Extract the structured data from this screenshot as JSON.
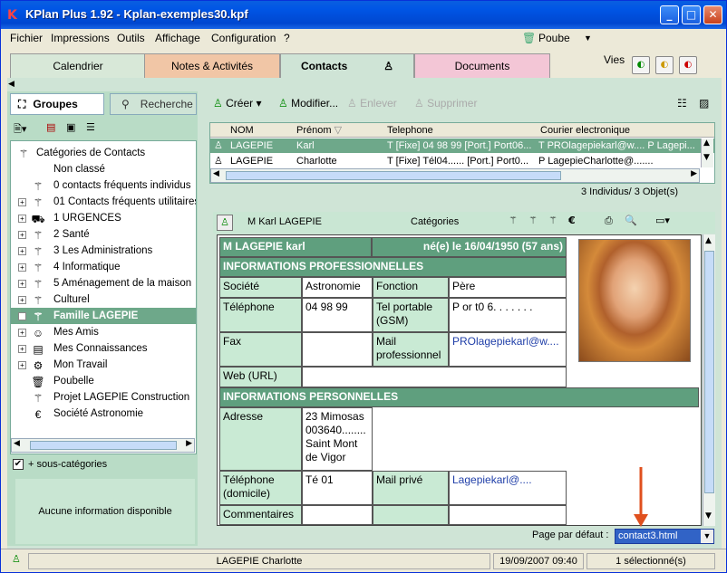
{
  "window": {
    "title": "KPlan Plus 1.92 - Kplan-exemples30.kpf",
    "app_icon": "K"
  },
  "menu": {
    "items": [
      "Fichier",
      "Impressions",
      "Outils",
      "Affichage",
      "Configuration",
      "?"
    ],
    "poube": "Poube"
  },
  "tabs": {
    "items": [
      "Calendrier",
      "Notes & Activités",
      "Contacts",
      "Documents"
    ],
    "active": "Contacts",
    "vies_label": "Vies"
  },
  "left": {
    "tabs": [
      "Groupes",
      "Recherche"
    ],
    "tree": [
      {
        "label": "Catégories de Contacts",
        "icon": "wand-icon"
      },
      {
        "label": "Non classé",
        "icon": ""
      },
      {
        "label": "0 contacts fréquents individus",
        "icon": "wand-icon"
      },
      {
        "label": "01 Contacts  fréquents utilitaires",
        "icon": "wand-icon"
      },
      {
        "label": "1 URGENCES",
        "icon": "truck-icon"
      },
      {
        "label": "2 Santé",
        "icon": "wand-icon"
      },
      {
        "label": "3  Les Administrations",
        "icon": "wand-icon"
      },
      {
        "label": "4 Informatique",
        "icon": "wand-icon"
      },
      {
        "label": "5 Aménagement de la maison",
        "icon": "wand-icon"
      },
      {
        "label": "Culturel",
        "icon": "wand-icon"
      },
      {
        "label": "Famille LAGEPIE",
        "icon": "wand-icon"
      },
      {
        "label": "Mes Amis",
        "icon": "smiley-icon"
      },
      {
        "label": "Mes Connaissances",
        "icon": "cards-icon"
      },
      {
        "label": "Mon Travail",
        "icon": "gear-icon"
      },
      {
        "label": "Poubelle",
        "icon": "trash-icon"
      },
      {
        "label": "Projet LAGEPIE Construction",
        "icon": "wand-icon"
      },
      {
        "label": "Société Astronomie",
        "icon": "euro-icon"
      }
    ],
    "selected_index": 10,
    "subcat_label": "+ sous-catégories",
    "no_info": "Aucune information disponible"
  },
  "toolbar": {
    "create": "Créer",
    "modify": "Modifier...",
    "remove": "Enlever",
    "delete": "Supprimer"
  },
  "grid": {
    "headers": [
      "NOM",
      "Prénom",
      "Telephone",
      "Courier electronique"
    ],
    "rows": [
      [
        "LAGEPIE",
        "Karl",
        "T [Fixe] 04 98 99 [Port.] Port06...",
        "T PROlagepiekarl@w....  P Lagepi..."
      ],
      [
        "LAGEPIE",
        "Charlotte",
        "T [Fixe] Tél04...... [Port.] Port0...",
        "P LagepieCharlotte@......."
      ]
    ],
    "count": "3 Individus/ 3 Objet(s)"
  },
  "card": {
    "header_name": "M Karl LAGEPIE",
    "categories": "Catégories",
    "name": "M LAGEPIE karl",
    "birth": "né(e) le 16/04/1950 (57 ans)",
    "pro_title": "INFORMATIONS PROFESSIONNELLES",
    "societe_label": "Société",
    "societe_value": "Astronomie",
    "fonction_label": "Fonction",
    "fonction_value": "Père",
    "tel_label": "Téléphone",
    "tel_value": "04 98 99",
    "telport_label": "Tel portable (GSM)",
    "telport_value": "P or t0 6. . . . . . .",
    "fax_label": "Fax",
    "mailpro_label": "Mail professionnel",
    "mailpro_value": "PROlagepiekarl@w....",
    "web_label": "Web (URL)",
    "perso_title": "INFORMATIONS PERSONNELLES",
    "adresse_label": "Adresse",
    "adresse_value": "23 Mimosas 003640........ Saint Mont de Vigor",
    "teldom_label": "Téléphone (domicile)",
    "teldom_value": "Té 01",
    "mailprive_label": "Mail privé",
    "mailprive_value": "Lagepiekarl@....",
    "comments_label": "Commentaires"
  },
  "pagedef": {
    "label": "Page par défaut :",
    "value": "contact3.html"
  },
  "status": {
    "name": "LAGEPIE Charlotte",
    "datetime": "19/09/2007 09:40",
    "selected": "1 sélectionné(s)"
  },
  "colors": {
    "accent_green": "#6ea88a",
    "panel_green": "#c9ead4",
    "selection_blue": "#3163c6"
  }
}
